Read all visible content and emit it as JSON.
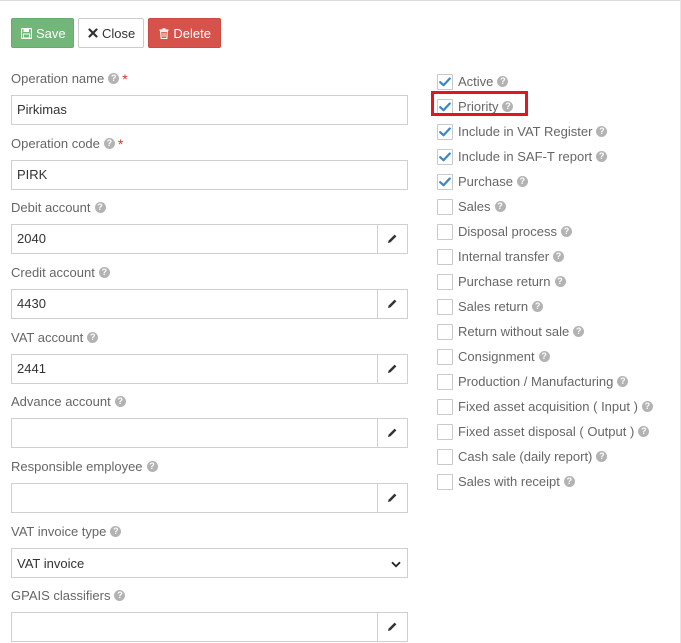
{
  "toolbar": {
    "save_label": "Save",
    "close_label": "Close",
    "delete_label": "Delete"
  },
  "form": {
    "operation_name": {
      "label": "Operation name",
      "value": "Pirkimas",
      "required_mark": "*"
    },
    "operation_code": {
      "label": "Operation code",
      "value": "PIRK",
      "required_mark": "*"
    },
    "debit_account": {
      "label": "Debit account",
      "value": "2040"
    },
    "credit_account": {
      "label": "Credit account",
      "value": "4430"
    },
    "vat_account": {
      "label": "VAT account",
      "value": "2441"
    },
    "advance_account": {
      "label": "Advance account",
      "value": ""
    },
    "responsible_employee": {
      "label": "Responsible employee",
      "value": ""
    },
    "vat_invoice_type": {
      "label": "VAT invoice type",
      "selected": "VAT invoice"
    },
    "gpais_classifiers": {
      "label": "GPAIS classifiers",
      "value": ""
    }
  },
  "checks": [
    {
      "label": "Active",
      "checked": true
    },
    {
      "label": "Priority",
      "checked": true
    },
    {
      "label": "Include in VAT Register",
      "checked": true
    },
    {
      "label": "Include in SAF-T report",
      "checked": true
    },
    {
      "label": "Purchase",
      "checked": true
    },
    {
      "label": "Sales",
      "checked": false
    },
    {
      "label": "Disposal process",
      "checked": false
    },
    {
      "label": "Internal transfer",
      "checked": false
    },
    {
      "label": "Purchase return",
      "checked": false
    },
    {
      "label": "Sales return",
      "checked": false
    },
    {
      "label": "Return without sale",
      "checked": false
    },
    {
      "label": "Consignment",
      "checked": false
    },
    {
      "label": "Production / Manufacturing",
      "checked": false
    },
    {
      "label": "Fixed asset acquisition ( Input )",
      "checked": false
    },
    {
      "label": "Fixed asset disposal ( Output )",
      "checked": false
    },
    {
      "label": "Cash sale (daily report)",
      "checked": false
    },
    {
      "label": "Sales with receipt",
      "checked": false
    }
  ],
  "icons": {
    "help": "question-circle-icon",
    "edit": "pencil-icon",
    "check": "checkmark-icon"
  },
  "colors": {
    "save": "#73b67a",
    "delete": "#d6534b",
    "check": "#3a87c8",
    "highlight": "#e0181b"
  }
}
